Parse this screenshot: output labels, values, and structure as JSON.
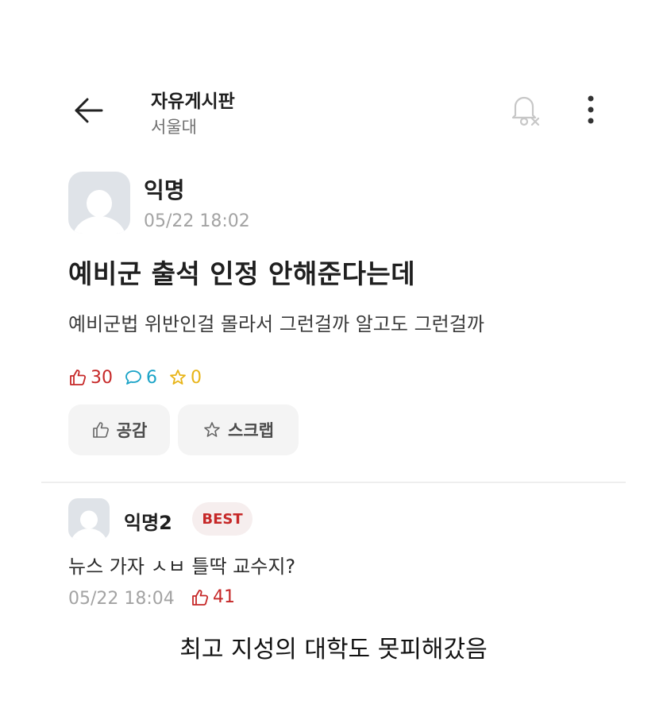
{
  "header": {
    "board_title": "자유게시판",
    "board_subtitle": "서울대",
    "back_icon": "arrow-left-icon",
    "notification_icon": "bell-off-icon",
    "more_icon": "more-vertical-icon"
  },
  "post": {
    "author": "익명",
    "time": "05/22 18:02",
    "title": "예비군 출석 인정 안해준다는데",
    "body": "예비군법 위반인걸 몰라서 그런걸까 알고도 그런걸까",
    "stats": {
      "likes": "30",
      "comments": "6",
      "scraps": "0"
    },
    "actions": {
      "like_label": "공감",
      "scrap_label": "스크랩"
    }
  },
  "comment": {
    "author": "익명2",
    "badge": "BEST",
    "text": "뉴스 가자 ㅅㅂ 틀딱 교수지?",
    "time": "05/22 18:04",
    "likes": "41"
  },
  "caption": "최고 지성의 대학도 못피해갔음",
  "colors": {
    "like": "#c62828",
    "comment": "#1aa3c7",
    "scrap": "#e8b417",
    "muted": "#a3a3a3",
    "button_bg": "#f4f4f4"
  }
}
